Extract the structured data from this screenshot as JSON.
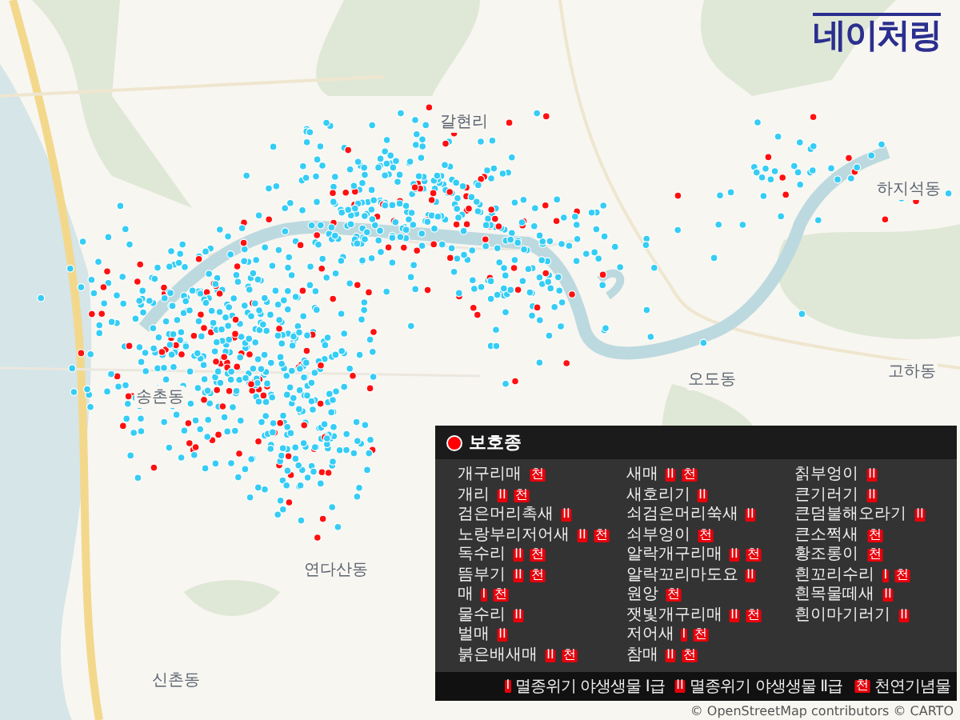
{
  "logo": "네이처링",
  "map": {
    "places": [
      "갈현리",
      "하지석동",
      "오도동",
      "고하동",
      "송촌동",
      "연다산동",
      "신촌동"
    ],
    "attribution": "© OpenStreetMap contributors © CARTO"
  },
  "legend": {
    "title": "보호종",
    "columns": [
      [
        {
          "name": "개구리매",
          "badges": [
            "천"
          ]
        },
        {
          "name": "개리",
          "badges": [
            "II",
            "천"
          ]
        },
        {
          "name": "검은머리촉새",
          "badges": [
            "II"
          ]
        },
        {
          "name": "노랑부리저어새",
          "badges": [
            "II",
            "천"
          ]
        },
        {
          "name": "독수리",
          "badges": [
            "II",
            "천"
          ]
        },
        {
          "name": "뜸부기",
          "badges": [
            "II",
            "천"
          ]
        },
        {
          "name": "매",
          "badges": [
            "I",
            "천"
          ]
        },
        {
          "name": "물수리",
          "badges": [
            "II"
          ]
        },
        {
          "name": "벌매",
          "badges": [
            "II"
          ]
        },
        {
          "name": "붉은배새매",
          "badges": [
            "II",
            "천"
          ]
        }
      ],
      [
        {
          "name": "새매",
          "badges": [
            "II",
            "천"
          ]
        },
        {
          "name": "새호리기",
          "badges": [
            "II"
          ]
        },
        {
          "name": "쇠검은머리쑥새",
          "badges": [
            "II"
          ]
        },
        {
          "name": "쇠부엉이",
          "badges": [
            "천"
          ]
        },
        {
          "name": "알락개구리매",
          "badges": [
            "II",
            "천"
          ]
        },
        {
          "name": "알락꼬리마도요",
          "badges": [
            "II"
          ]
        },
        {
          "name": "원앙",
          "badges": [
            "천"
          ]
        },
        {
          "name": "잿빛개구리매",
          "badges": [
            "II",
            "천"
          ]
        },
        {
          "name": "저어새",
          "badges": [
            "I",
            "천"
          ]
        },
        {
          "name": "참매",
          "badges": [
            "II",
            "천"
          ]
        }
      ],
      [
        {
          "name": "칡부엉이",
          "badges": [
            "II"
          ]
        },
        {
          "name": "큰기러기",
          "badges": [
            "II"
          ]
        },
        {
          "name": "큰덤불해오라기",
          "badges": [
            "II"
          ]
        },
        {
          "name": "큰소쩍새",
          "badges": [
            "천"
          ]
        },
        {
          "name": "황조롱이",
          "badges": [
            "천"
          ]
        },
        {
          "name": "흰꼬리수리",
          "badges": [
            "I",
            "천"
          ]
        },
        {
          "name": "흰목물떼새",
          "badges": [
            "II"
          ]
        },
        {
          "name": "흰이마기러기",
          "badges": [
            "II"
          ]
        }
      ]
    ],
    "key": [
      {
        "badge": "I",
        "label": "멸종위기 야생생물 Ⅰ급"
      },
      {
        "badge": "II",
        "label": "멸종위기 야생생물 Ⅱ급"
      },
      {
        "badge": "천",
        "label": "천연기념물"
      }
    ]
  }
}
